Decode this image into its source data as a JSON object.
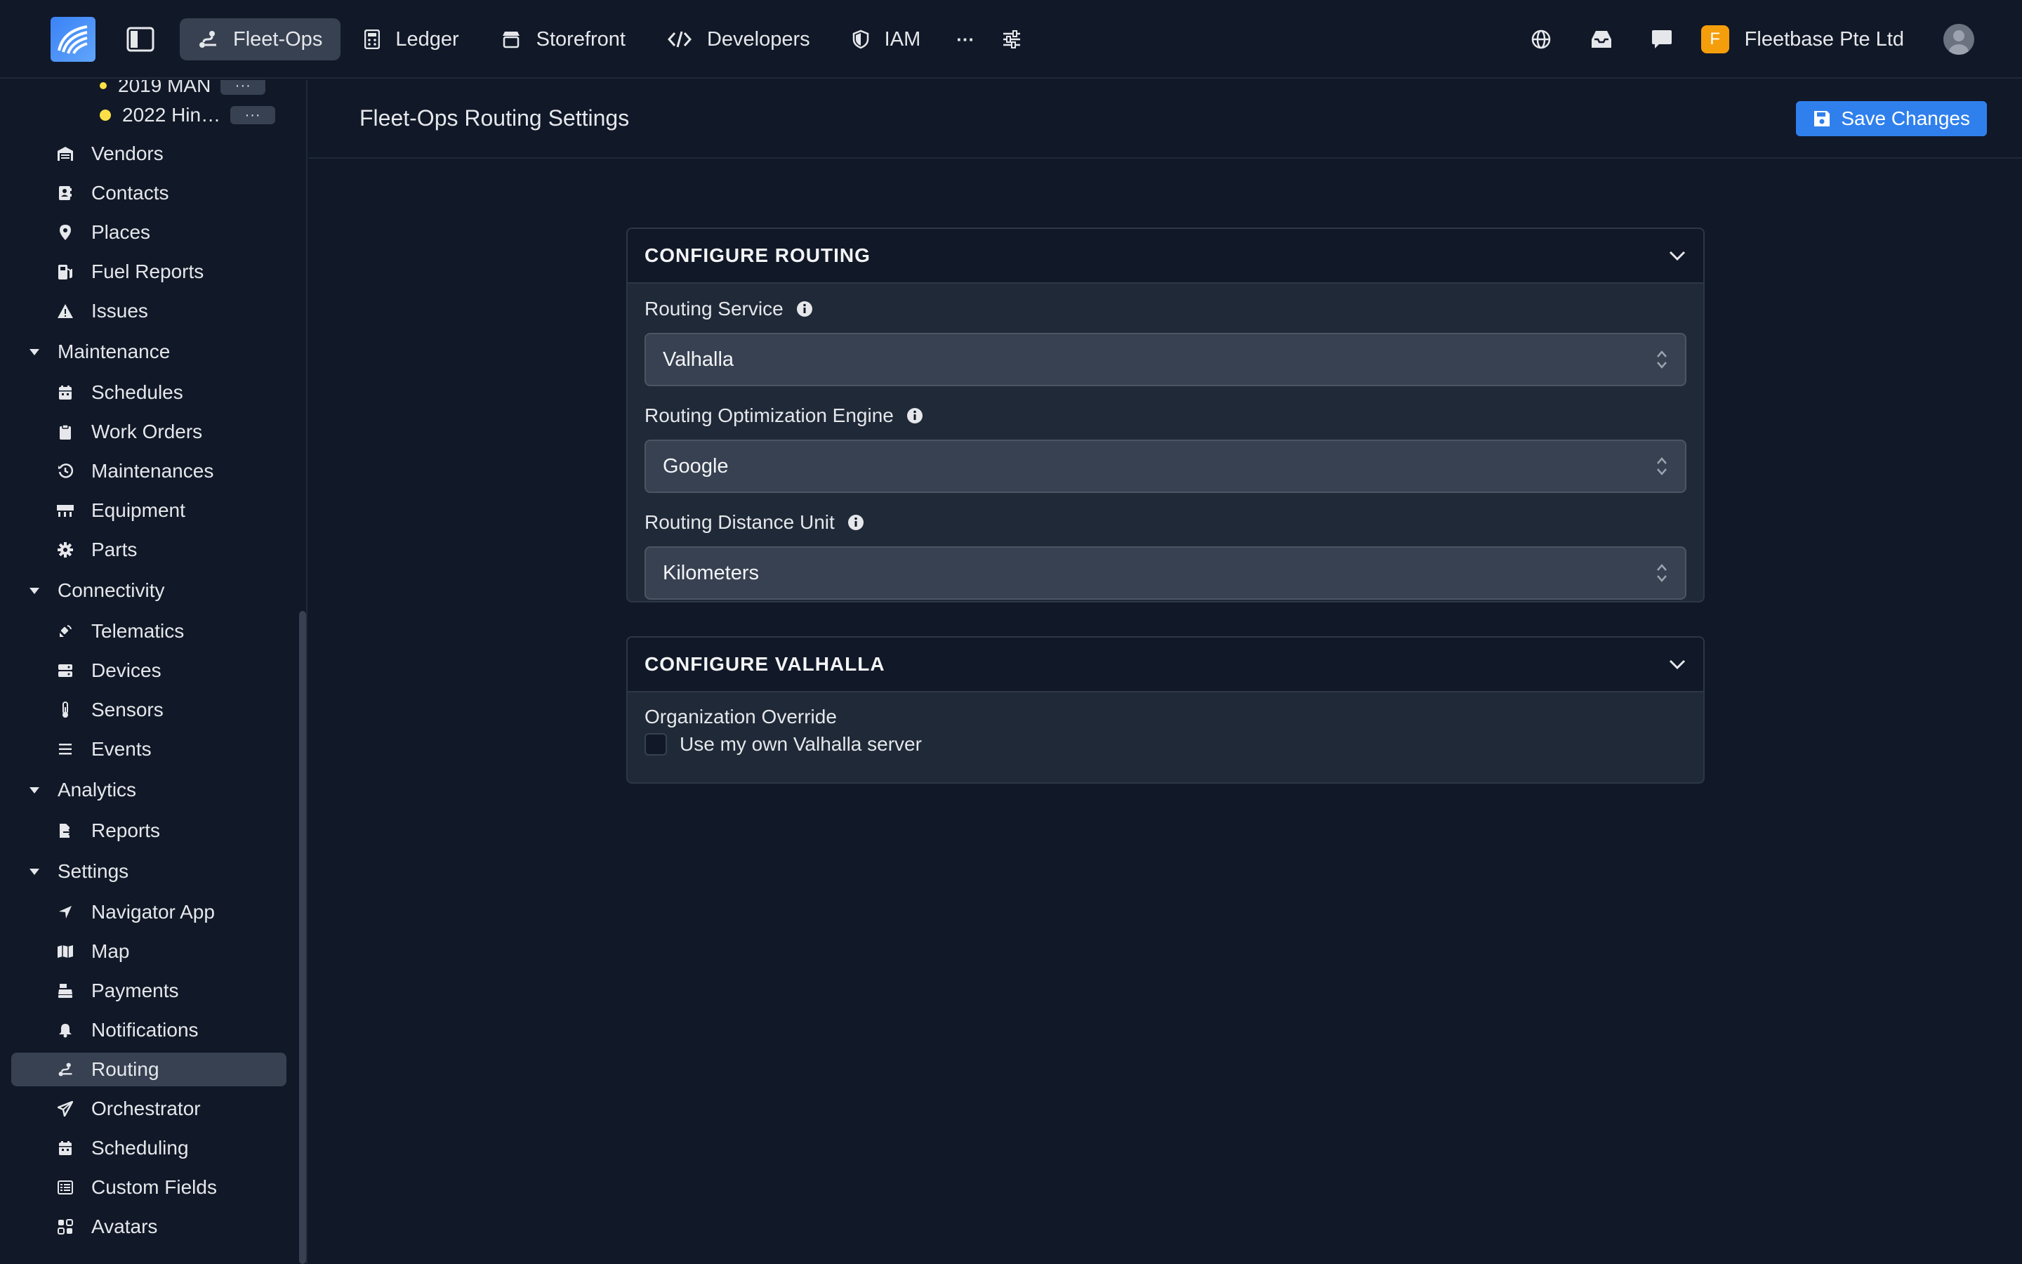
{
  "topbar": {
    "nav": [
      {
        "label": "Fleet-Ops",
        "icon": "route-icon",
        "active": true
      },
      {
        "label": "Ledger",
        "icon": "calculator-icon"
      },
      {
        "label": "Storefront",
        "icon": "store-icon"
      },
      {
        "label": "Developers",
        "icon": "code-icon"
      },
      {
        "label": "IAM",
        "icon": "shield-icon"
      }
    ],
    "more_label": "···",
    "org_initial": "F",
    "org_name": "Fleetbase Pte Ltd"
  },
  "sidebar": {
    "sub_items": [
      {
        "label": "2019 MAN",
        "more": "···"
      },
      {
        "label": "2022 Hin…",
        "more": "···"
      }
    ],
    "items_top": [
      {
        "label": "Vendors",
        "icon": "warehouse-icon"
      },
      {
        "label": "Contacts",
        "icon": "address-book-icon"
      },
      {
        "label": "Places",
        "icon": "map-pin-icon"
      },
      {
        "label": "Fuel Reports",
        "icon": "gas-pump-icon"
      },
      {
        "label": "Issues",
        "icon": "warning-icon"
      }
    ],
    "groups": {
      "maintenance": "Maintenance",
      "connectivity": "Connectivity",
      "analytics": "Analytics",
      "settings": "Settings"
    },
    "maintenance_items": [
      {
        "label": "Schedules",
        "icon": "calendar-icon"
      },
      {
        "label": "Work Orders",
        "icon": "clipboard-icon"
      },
      {
        "label": "Maintenances",
        "icon": "history-icon"
      },
      {
        "label": "Equipment",
        "icon": "pallet-icon"
      },
      {
        "label": "Parts",
        "icon": "cog-icon"
      }
    ],
    "connectivity_items": [
      {
        "label": "Telematics",
        "icon": "satellite-icon"
      },
      {
        "label": "Devices",
        "icon": "server-icon"
      },
      {
        "label": "Sensors",
        "icon": "thermometer-icon"
      },
      {
        "label": "Events",
        "icon": "list-icon"
      }
    ],
    "analytics_items": [
      {
        "label": "Reports",
        "icon": "file-export-icon"
      }
    ],
    "settings_items": [
      {
        "label": "Navigator App",
        "icon": "location-arrow-icon"
      },
      {
        "label": "Map",
        "icon": "map-icon"
      },
      {
        "label": "Payments",
        "icon": "cash-register-icon"
      },
      {
        "label": "Notifications",
        "icon": "bell-icon"
      },
      {
        "label": "Routing",
        "icon": "route-icon",
        "active": true
      },
      {
        "label": "Orchestrator",
        "icon": "paper-plane-icon"
      },
      {
        "label": "Scheduling",
        "icon": "calendar-icon"
      },
      {
        "label": "Custom Fields",
        "icon": "table-list-icon"
      },
      {
        "label": "Avatars",
        "icon": "avatars-icon"
      }
    ]
  },
  "main": {
    "title": "Fleet-Ops Routing Settings",
    "save_label": "Save Changes",
    "routing_panel": {
      "title": "CONFIGURE ROUTING",
      "fields": [
        {
          "label": "Routing Service",
          "value": "Valhalla"
        },
        {
          "label": "Routing Optimization Engine",
          "value": "Google"
        },
        {
          "label": "Routing Distance Unit",
          "value": "Kilometers"
        }
      ]
    },
    "valhalla_panel": {
      "title": "CONFIGURE VALHALLA",
      "section_label": "Organization Override",
      "checkbox_label": "Use my own Valhalla server",
      "checked": false
    }
  },
  "colors": {
    "background": "#111827",
    "panel": "#1f2937",
    "accent": "#2f80ed",
    "active": "#374151",
    "org_badge": "#f59e0b",
    "status_dot": "#fde047"
  }
}
